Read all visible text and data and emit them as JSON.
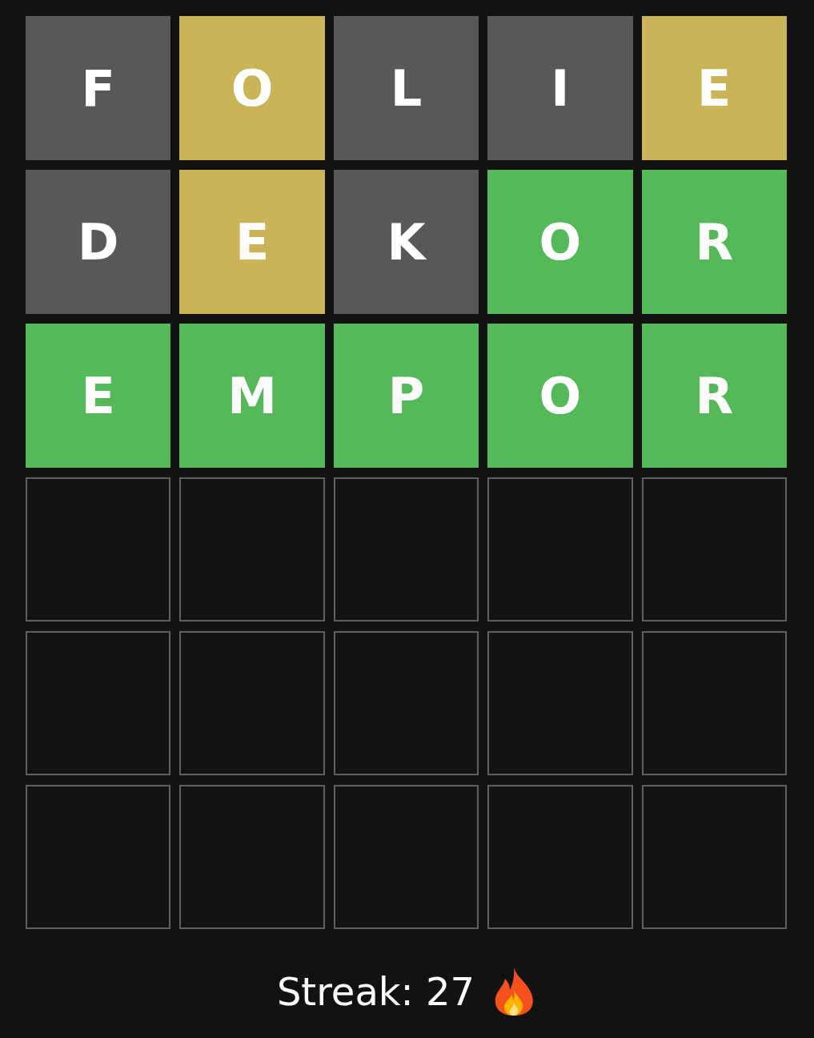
{
  "board": [
    {
      "tiles": [
        {
          "kind": "letter",
          "letter": "F",
          "color": "#585858"
        },
        {
          "kind": "letter",
          "letter": "O",
          "color": "#c9b458"
        },
        {
          "kind": "letter",
          "letter": "L",
          "color": "#585858"
        },
        {
          "kind": "letter",
          "letter": "I",
          "color": "#585858"
        },
        {
          "kind": "letter",
          "letter": "E",
          "color": "#c9b458"
        }
      ]
    },
    {
      "tiles": [
        {
          "kind": "letter",
          "letter": "D",
          "color": "#585858"
        },
        {
          "kind": "letter",
          "letter": "E",
          "color": "#c9b458"
        },
        {
          "kind": "letter",
          "letter": "K",
          "color": "#585858"
        },
        {
          "kind": "letter",
          "letter": "O",
          "color": "#55b95a"
        },
        {
          "kind": "letter",
          "letter": "R",
          "color": "#55b95a"
        }
      ]
    },
    {
      "tiles": [
        {
          "kind": "letter",
          "letter": "E",
          "color": "#55b95a"
        },
        {
          "kind": "letter",
          "letter": "M",
          "color": "#55b95a"
        },
        {
          "kind": "letter",
          "letter": "P",
          "color": "#55b95a"
        },
        {
          "kind": "letter",
          "letter": "O",
          "color": "#55b95a"
        },
        {
          "kind": "letter",
          "letter": "R",
          "color": "#55b95a"
        }
      ]
    },
    {
      "tiles": [
        {
          "kind": "empty"
        },
        {
          "kind": "empty"
        },
        {
          "kind": "empty"
        },
        {
          "kind": "empty"
        },
        {
          "kind": "empty"
        }
      ]
    },
    {
      "tiles": [
        {
          "kind": "empty"
        },
        {
          "kind": "empty"
        },
        {
          "kind": "empty"
        },
        {
          "kind": "empty"
        },
        {
          "kind": "empty"
        }
      ]
    },
    {
      "tiles": [
        {
          "kind": "empty"
        },
        {
          "kind": "empty"
        },
        {
          "kind": "empty"
        },
        {
          "kind": "empty"
        },
        {
          "kind": "empty"
        }
      ]
    }
  ],
  "streak": "Streak: 27"
}
